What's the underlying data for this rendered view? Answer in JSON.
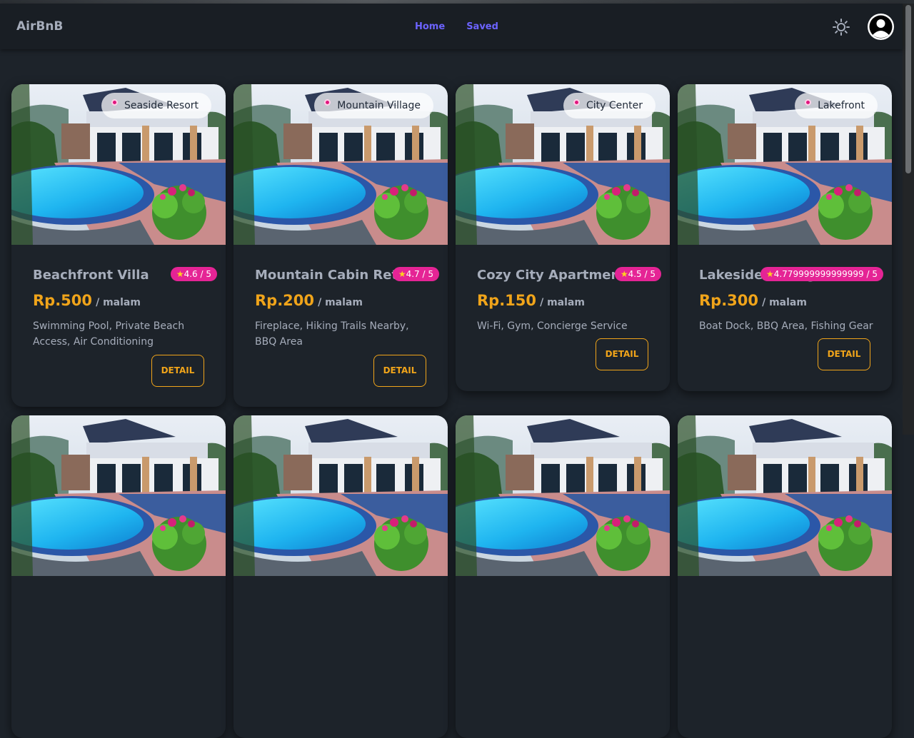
{
  "navbar": {
    "brand": "AirBnB",
    "links": [
      "Home",
      "Saved"
    ]
  },
  "colors": {
    "accent_link": "#6c63ff",
    "price": "#f0a41a",
    "rating_badge": "#e52495",
    "background": "#1d232a"
  },
  "cards": [
    {
      "location": "Seaside Resort",
      "title": "Beachfront Villa",
      "rating": "4.6 / 5",
      "price": "Rp.500",
      "unit": "/ malam",
      "amenities": "Swimming Pool, Private Beach Access, Air Conditioning",
      "button": "DETAIL"
    },
    {
      "location": "Mountain Village",
      "title": "Mountain Cabin Retreat",
      "rating": "4.7 / 5",
      "price": "Rp.200",
      "unit": "/ malam",
      "amenities": "Fireplace, Hiking Trails Nearby, BBQ Area",
      "button": "DETAIL"
    },
    {
      "location": "City Center",
      "title": "Cozy City Apartment",
      "rating": "4.5 / 5",
      "price": "Rp.150",
      "unit": "/ malam",
      "amenities": "Wi-Fi, Gym, Concierge Service",
      "button": "DETAIL"
    },
    {
      "location": "Lakefront",
      "title": "Lakeside Cottage",
      "rating": "4.779999999999999 / 5",
      "price": "Rp.300",
      "unit": "/ malam",
      "amenities": "Boat Dock, BBQ Area, Fishing Gear",
      "button": "DETAIL"
    }
  ],
  "icons": {
    "theme": "sun-icon",
    "avatar": "user-avatar-icon",
    "rating": "star-icon"
  }
}
